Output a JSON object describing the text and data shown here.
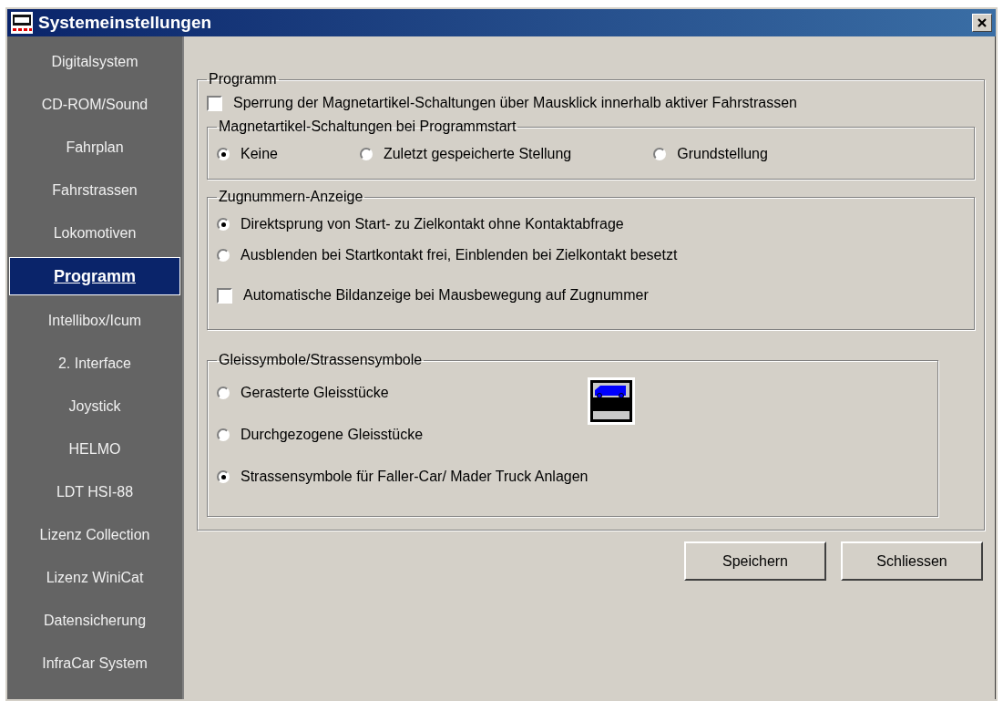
{
  "window": {
    "title": "Systemeinstellungen"
  },
  "sidebar": {
    "items": [
      {
        "label": "Digitalsystem",
        "selected": false
      },
      {
        "label": "CD-ROM/Sound",
        "selected": false
      },
      {
        "label": "Fahrplan",
        "selected": false
      },
      {
        "label": "Fahrstrassen",
        "selected": false
      },
      {
        "label": "Lokomotiven",
        "selected": false
      },
      {
        "label": "Programm",
        "selected": true
      },
      {
        "label": "Intellibox/Icum",
        "selected": false
      },
      {
        "label": "2. Interface",
        "selected": false
      },
      {
        "label": "Joystick",
        "selected": false
      },
      {
        "label": "HELMO",
        "selected": false
      },
      {
        "label": "LDT HSI-88",
        "selected": false
      },
      {
        "label": "Lizenz Collection",
        "selected": false
      },
      {
        "label": "Lizenz WiniCat",
        "selected": false
      },
      {
        "label": "Datensicherung",
        "selected": false
      },
      {
        "label": "InfraCar System",
        "selected": false
      }
    ]
  },
  "program": {
    "title": "Programm",
    "lock_option": {
      "label": "Sperrung der Magnetartikel-Schaltungen über Mausklick innerhalb aktiver Fahrstrassen",
      "checked": false
    },
    "startup_group": {
      "title": "Magnetartikel-Schaltungen bei Programmstart",
      "options": [
        {
          "label": "Keine",
          "selected": true
        },
        {
          "label": "Zuletzt gespeicherte Stellung",
          "selected": false
        },
        {
          "label": "Grundstellung",
          "selected": false
        }
      ]
    },
    "train_number_group": {
      "title": "Zugnummern-Anzeige",
      "options": [
        {
          "label": "Direktsprung von Start- zu  Zielkontakt ohne Kontaktabfrage",
          "selected": true
        },
        {
          "label": "Ausblenden bei Startkontakt frei, Einblenden bei Zielkontakt besetzt",
          "selected": false
        }
      ],
      "auto_image": {
        "label": "Automatische Bildanzeige bei Mausbewegung auf Zugnummer",
        "checked": false
      }
    },
    "symbol_group": {
      "title": "Gleissymbole/Strassensymbole",
      "options": [
        {
          "label": "Gerasterte Gleisstücke",
          "selected": false
        },
        {
          "label": "Durchgezogene Gleisstücke",
          "selected": false
        },
        {
          "label": "Strassensymbole für Faller-Car/ Mader Truck Anlagen",
          "selected": true
        }
      ]
    }
  },
  "buttons": [
    "Speichern",
    "Schliessen"
  ]
}
